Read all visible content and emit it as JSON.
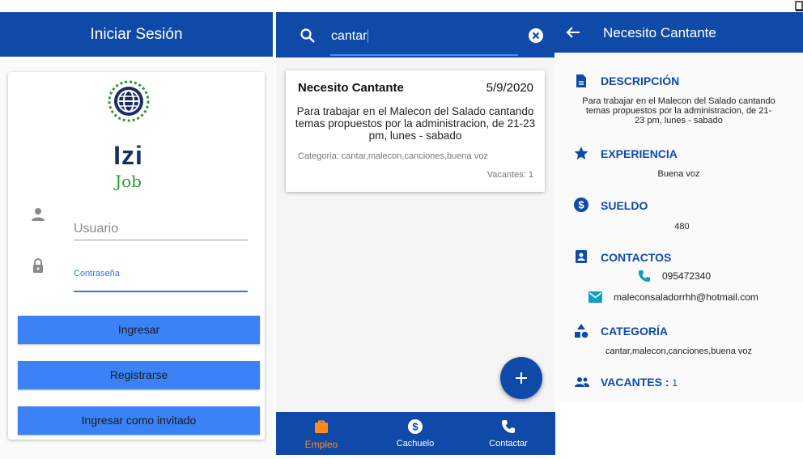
{
  "login": {
    "title": "Iniciar Sesión",
    "logo": {
      "izi": "Izi",
      "job": "Job"
    },
    "username_placeholder": "Usuario",
    "password_label": "Contraseña",
    "buttons": {
      "login": "Ingresar",
      "register": "Registrarse",
      "guest": "Ingresar como invitado"
    },
    "icons": {
      "user": "person-icon",
      "lock": "lock-icon",
      "logo": "globe-icon"
    }
  },
  "search": {
    "query": "cantar",
    "icons": {
      "search": "search-icon",
      "clear": "clear-icon",
      "fab": "add-icon"
    },
    "results": [
      {
        "title": "Necesito Cantante",
        "date": "5/9/2020",
        "description": "Para trabajar en el Malecon del Salado cantando temas propuestos por la administracion, de 21-23 pm, lunes - sabado",
        "category": "Categoria: cantar,malecon,canciones,buena voz",
        "vacancies": "Vacantes: 1"
      }
    ],
    "fab_label": "+",
    "nav": [
      {
        "label": "Empleo",
        "icon": "briefcase-icon",
        "selected": true
      },
      {
        "label": "Cachuelo",
        "icon": "dollar-icon",
        "selected": false
      },
      {
        "label": "Contactar",
        "icon": "phone-icon",
        "selected": false
      }
    ]
  },
  "detail": {
    "title": "Necesito Cantante",
    "sections": {
      "description": {
        "heading": "DESCRIPCIÓN",
        "text": "Para trabajar en el Malecon del Salado cantando temas propuestos por la administracion, de 21-23 pm, lunes - sabado"
      },
      "experience": {
        "heading": "EXPERIENCIA",
        "text": "Buena voz"
      },
      "salary": {
        "heading": "SUELDO",
        "text": "480"
      },
      "contacts": {
        "heading": "CONTACTOS",
        "phone": "095472340",
        "email": "maleconsaladorrhh@hotmail.com"
      },
      "category": {
        "heading": "CATEGORÍA",
        "text": "cantar,malecon,canciones,buena voz"
      },
      "vacancies": {
        "heading": "VACANTES : ",
        "count": "1"
      }
    }
  },
  "colors": {
    "primary": "#0f4aa8",
    "accent": "#3b82f6",
    "selected_nav": "#ff8c1a",
    "logo_green": "#2e9930"
  }
}
